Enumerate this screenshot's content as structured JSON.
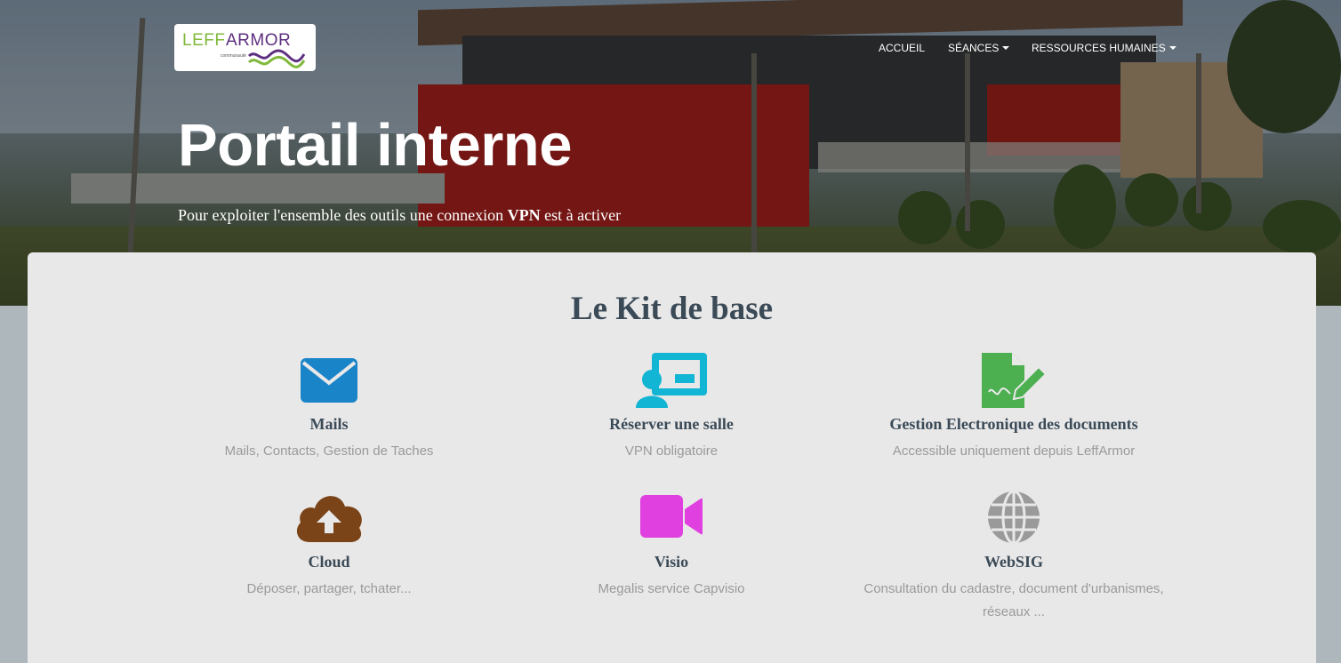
{
  "logo": {
    "text_green": "LEFF",
    "text_purple": "ARMOR",
    "subtitle": "communauté"
  },
  "nav": {
    "items": [
      {
        "label": "ACCUEIL",
        "dropdown": false
      },
      {
        "label": "SÉANCES",
        "dropdown": true
      },
      {
        "label": "RESSOURCES HUMAINES",
        "dropdown": true
      }
    ]
  },
  "hero": {
    "title": "Portail interne",
    "subtitle_before": "Pour exploiter l'ensemble des outils une connexion ",
    "subtitle_bold": "VPN",
    "subtitle_after": " est à activer"
  },
  "kit": {
    "title": "Le Kit de base",
    "features": [
      {
        "title": "Mails",
        "desc": "Mails, Contacts, Gestion de Taches",
        "icon": "envelope-icon",
        "color": "#1a84c8"
      },
      {
        "title": "Réserver une salle",
        "desc": "VPN obligatoire",
        "icon": "presentation-icon",
        "color": "#12b5d4"
      },
      {
        "title": "Gestion Electronique des documents",
        "desc": "Accessible uniquement depuis LeffArmor",
        "icon": "document-signature-icon",
        "color": "#4caf50"
      },
      {
        "title": "Cloud",
        "desc": "Déposer, partager, tchater...",
        "icon": "cloud-upload-icon",
        "color": "#7a4418"
      },
      {
        "title": "Visio",
        "desc": "Megalis service Capvisio",
        "icon": "video-camera-icon",
        "color": "#e040e0"
      },
      {
        "title": "WebSIG",
        "desc": "Consultation du cadastre, document d'urbanismes, réseaux ...",
        "icon": "globe-icon",
        "color": "#9a9a9a"
      }
    ]
  }
}
